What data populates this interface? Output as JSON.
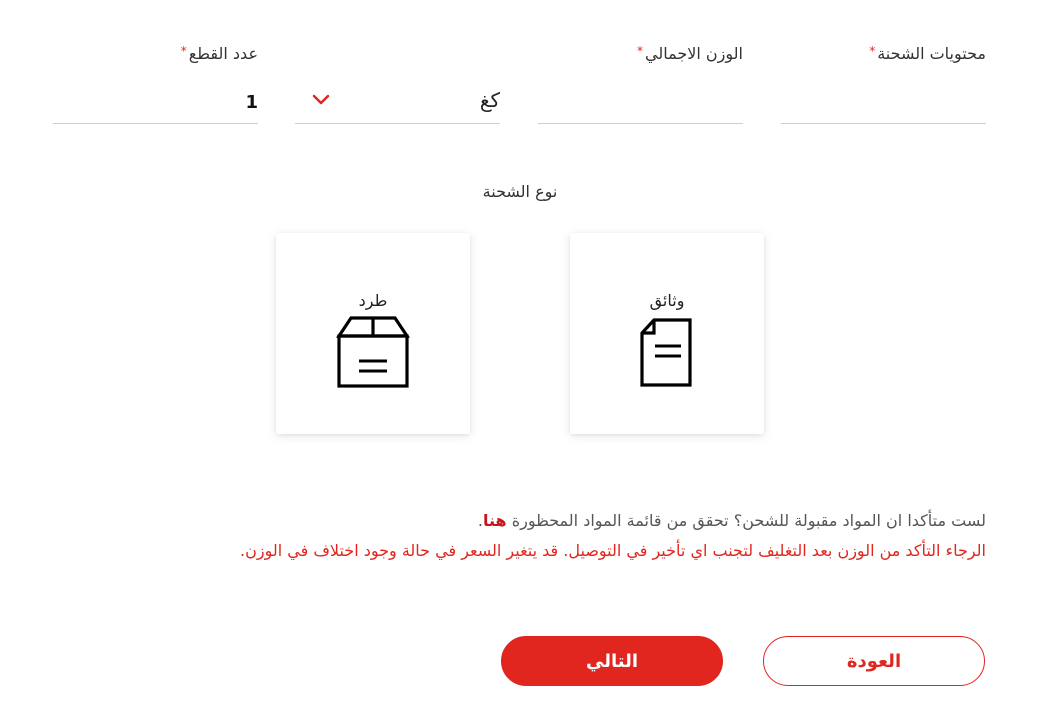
{
  "form": {
    "contents": {
      "label": "محتويات الشحنة",
      "required": "*",
      "value": ""
    },
    "weight": {
      "label": "الوزن الاجمالي",
      "required": "*",
      "value": ""
    },
    "unit": {
      "selected": "كغ"
    },
    "pieces": {
      "label": "عدد القطع",
      "required": "*",
      "value": "1"
    }
  },
  "shipment_type": {
    "title": "نوع الشحنة",
    "options": [
      {
        "label": "وثائق",
        "icon": "document-icon"
      },
      {
        "label": "طرد",
        "icon": "package-box-icon"
      }
    ]
  },
  "notes": {
    "question": "لست متأكدا ان المواد مقبولة للشحن؟ تحقق من قائمة المواد المحظورة",
    "link": "هنا",
    "link_suffix": ".",
    "warning": "الرجاء التأكد من الوزن بعد التغليف لتجنب اي تأخير في التوصيل. قد يتغير السعر في حالة وجود اختلاف في الوزن."
  },
  "buttons": {
    "back": "العودة",
    "next": "التالي"
  },
  "colors": {
    "accent": "#e0261e",
    "link": "#c8151a"
  }
}
